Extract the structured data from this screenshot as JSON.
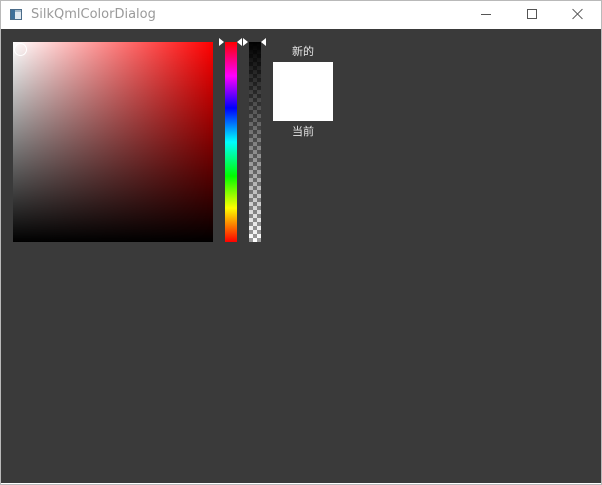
{
  "window": {
    "title": "SilkQmlColorDialog"
  },
  "window_controls": {
    "icons": [
      "minimize-icon",
      "maximize-icon",
      "close-icon"
    ]
  },
  "color_picker": {
    "hue_color": "#ff0000",
    "hue_position": 0,
    "saturation": 0,
    "value": 1,
    "alpha": 1,
    "new_color": "#ffffff",
    "current_color": "#ffffff",
    "new_label": "新的",
    "current_label": "当前"
  }
}
